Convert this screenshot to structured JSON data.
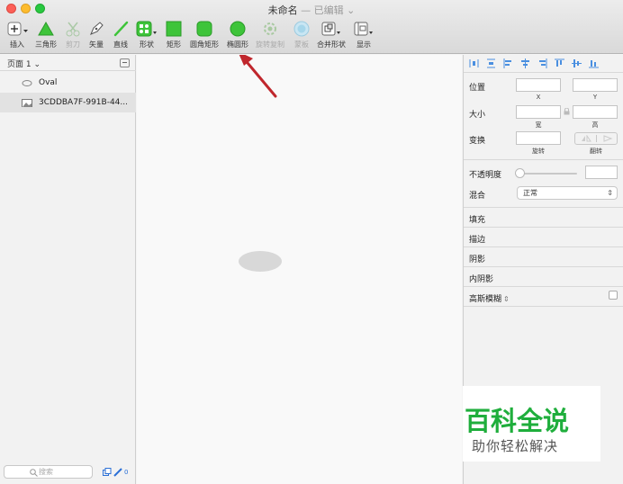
{
  "window": {
    "title": "未命名",
    "title_sep": " — ",
    "title_status": "已编辑 ⌄"
  },
  "toolbar": {
    "items": [
      {
        "label": "插入",
        "icon": "plus-icon",
        "disabled": false
      },
      {
        "label": "三角形",
        "icon": "triangle-icon",
        "disabled": false
      },
      {
        "label": "剪刀",
        "icon": "scissors-icon",
        "disabled": true
      },
      {
        "label": "矢量",
        "icon": "pen-icon",
        "disabled": false
      },
      {
        "label": "直线",
        "icon": "line-icon",
        "disabled": false
      },
      {
        "label": "形状",
        "icon": "shapes-icon",
        "disabled": false
      },
      {
        "label": "矩形",
        "icon": "rectangle-icon",
        "disabled": false
      },
      {
        "label": "圆角矩形",
        "icon": "rounded-rectangle-icon",
        "disabled": false
      },
      {
        "label": "椭圆形",
        "icon": "oval-icon",
        "disabled": false
      },
      {
        "label": "旋转复制",
        "icon": "rotate-copy-icon",
        "disabled": true
      },
      {
        "label": "蒙板",
        "icon": "mask-icon",
        "disabled": true
      },
      {
        "label": "合并形状",
        "icon": "combine-shapes-icon",
        "disabled": false
      },
      {
        "label": "显示",
        "icon": "view-icon",
        "disabled": false
      }
    ]
  },
  "sidebar": {
    "page": "页面 1 ⌄",
    "layers": [
      {
        "name": "Oval",
        "icon": "oval-layer-icon",
        "selected": false
      },
      {
        "name": "3CDDBA7F-991B-44...",
        "icon": "image-layer-icon",
        "selected": true
      }
    ],
    "search_placeholder": "搜索",
    "badge_count": "0"
  },
  "inspector": {
    "position": "位置",
    "x": "X",
    "y": "Y",
    "size": "大小",
    "width": "宽",
    "height": "高",
    "transform": "变换",
    "rotate": "旋转",
    "flip": "翻转",
    "opacity": "不透明度",
    "blend": "混合",
    "blend_value": "正常",
    "fill": "填充",
    "border": "描边",
    "shadow": "阴影",
    "inner_shadow": "内阴影",
    "gaussian_blur": "高斯模糊"
  },
  "watermark": {
    "main": "百科全说",
    "sub": "助你轻松解决"
  },
  "colors": {
    "accent_green": "#1fae3c",
    "arrow_red": "#c0272d",
    "shape_green": "#3ec43a"
  }
}
